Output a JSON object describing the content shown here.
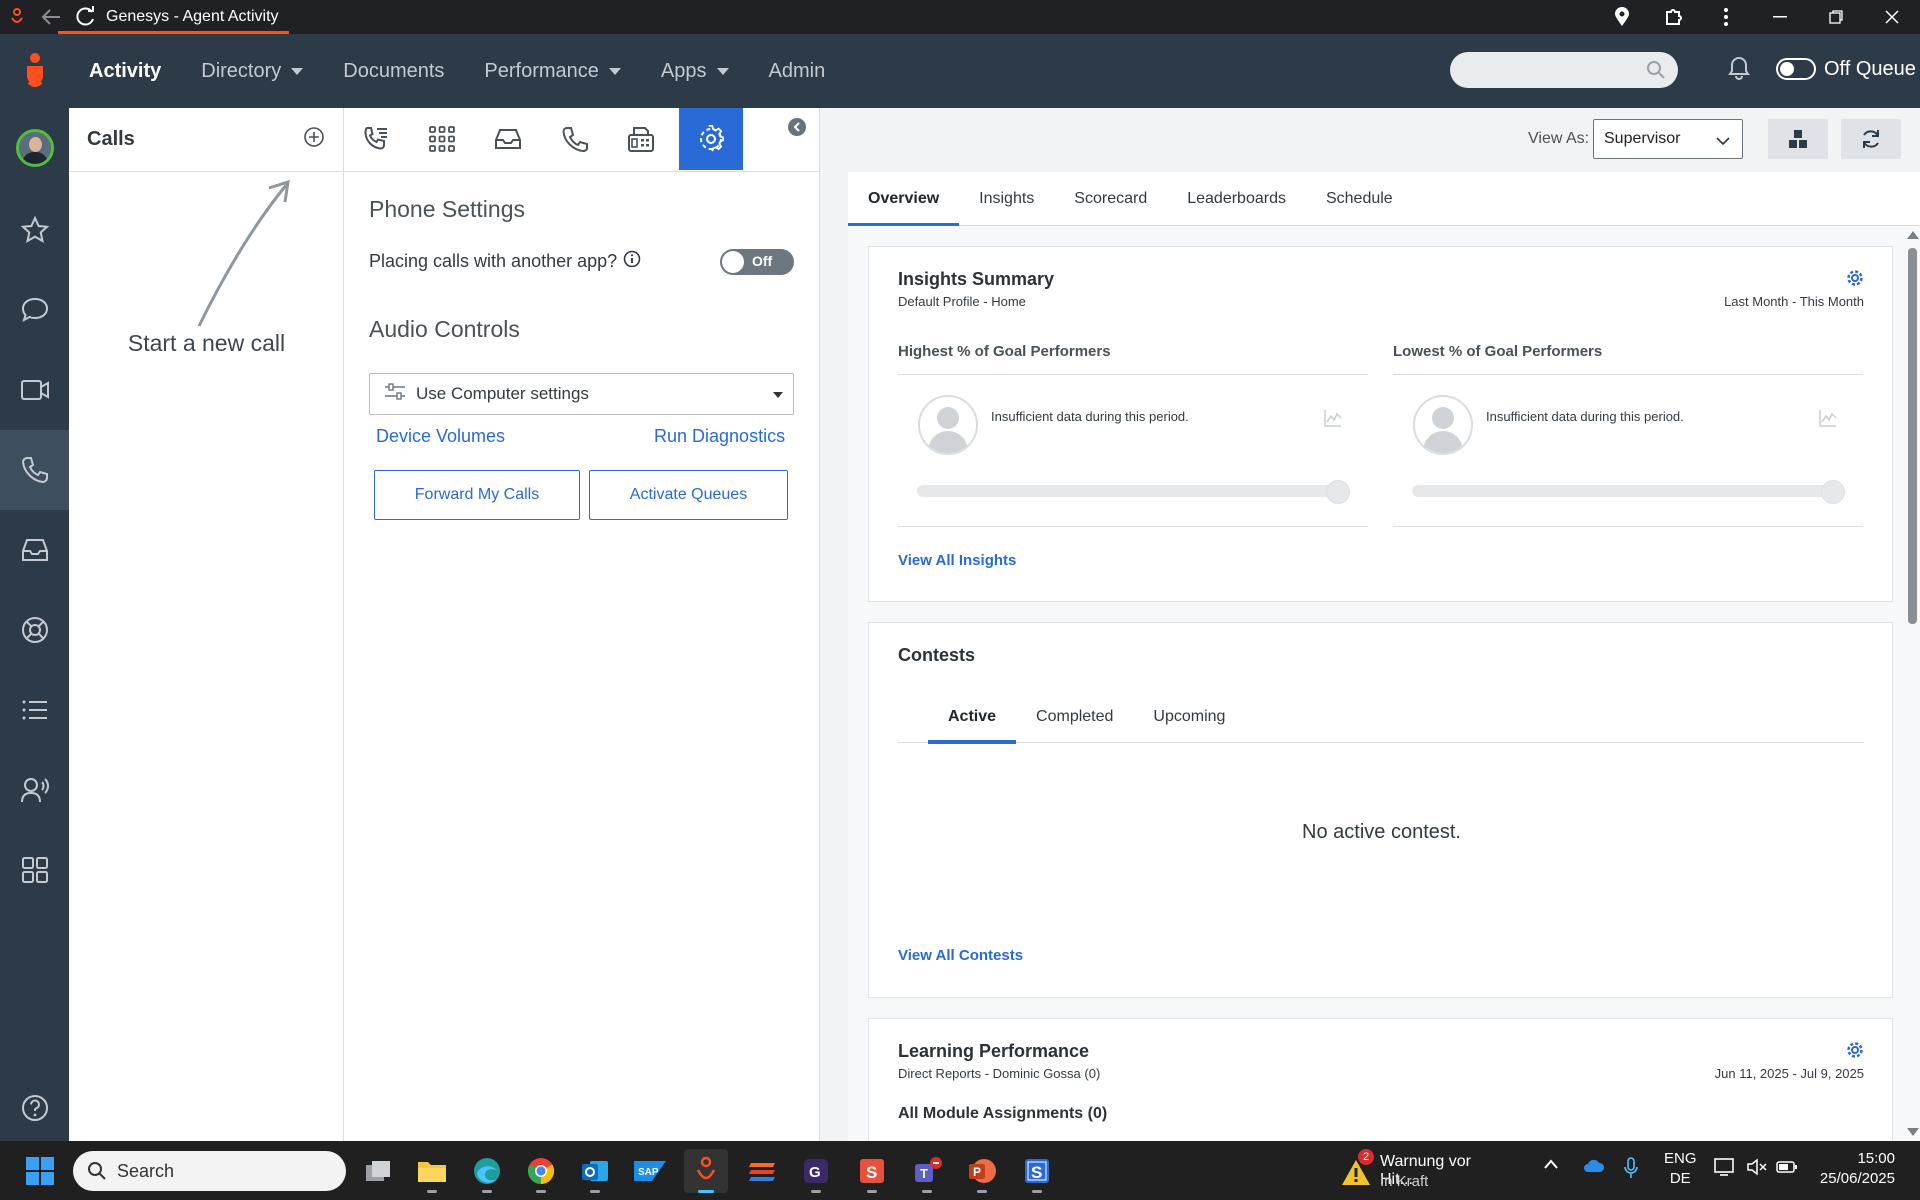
{
  "titlebar": {
    "title": "Genesys - Agent Activity"
  },
  "topnav": {
    "items": [
      {
        "label": "Activity",
        "active": true,
        "dropdown": false
      },
      {
        "label": "Directory",
        "active": false,
        "dropdown": true
      },
      {
        "label": "Documents",
        "active": false,
        "dropdown": false
      },
      {
        "label": "Performance",
        "active": false,
        "dropdown": true
      },
      {
        "label": "Apps",
        "active": false,
        "dropdown": true
      },
      {
        "label": "Admin",
        "active": false,
        "dropdown": false
      }
    ],
    "queue_label": "Off Queue"
  },
  "sidebar": {
    "items": [
      "avatar",
      "star-icon",
      "chat-icon",
      "video-icon",
      "phone-icon",
      "inbox-icon",
      "lifebuoy-icon",
      "list-icon",
      "agent-voice-icon",
      "apps-icon"
    ],
    "active": "phone-icon",
    "help": "help-icon"
  },
  "calls": {
    "title": "Calls",
    "empty_text": "Start a new call"
  },
  "phone_settings": {
    "toolbar": [
      "call-list-icon",
      "dialpad-icon",
      "inbox-icon",
      "phone-icon",
      "fax-icon",
      "settings-icon"
    ],
    "active_tool": "settings-icon",
    "title": "Phone Settings",
    "placing_label": "Placing calls with another app?",
    "toggle_label": "Off",
    "audio_title": "Audio Controls",
    "audio_select": "Use Computer settings",
    "device_volumes": "Device Volumes",
    "run_diagnostics": "Run Diagnostics",
    "forward_calls": "Forward My Calls",
    "activate_queues": "Activate Queues"
  },
  "main": {
    "view_as_label": "View As:",
    "view_as_value": "Supervisor",
    "tabs": [
      "Overview",
      "Insights",
      "Scorecard",
      "Leaderboards",
      "Schedule"
    ],
    "active_tab": "Overview",
    "insights": {
      "title": "Insights Summary",
      "subtitle": "Default Profile - Home",
      "range": "Last Month - This Month",
      "highest_head": "Highest % of Goal Performers",
      "lowest_head": "Lowest % of Goal Performers",
      "no_data": "Insufficient data during this period.",
      "view_all": "View All Insights"
    },
    "contests": {
      "title": "Contests",
      "tabs": [
        "Active",
        "Completed",
        "Upcoming"
      ],
      "active_tab": "Active",
      "empty": "No active contest.",
      "view_all": "View All Contests"
    },
    "learning": {
      "title": "Learning Performance",
      "subtitle": "Direct Reports - Dominic Gossa (0)",
      "range": "Jun 11, 2025 - Jul 9, 2025",
      "partial": "All Module Assignments (0)"
    }
  },
  "taskbar": {
    "search_placeholder": "Search",
    "notification_count": "2",
    "notification_title": "Warnung vor Hit...",
    "notification_sub": "In Kraft",
    "lang_1": "ENG",
    "lang_2": "DE",
    "time": "15:00",
    "date": "25/06/2025"
  },
  "colors": {
    "accent": "#2a6ad6",
    "brand": "#ff4f1f",
    "nav_bg": "#2d3a48"
  }
}
